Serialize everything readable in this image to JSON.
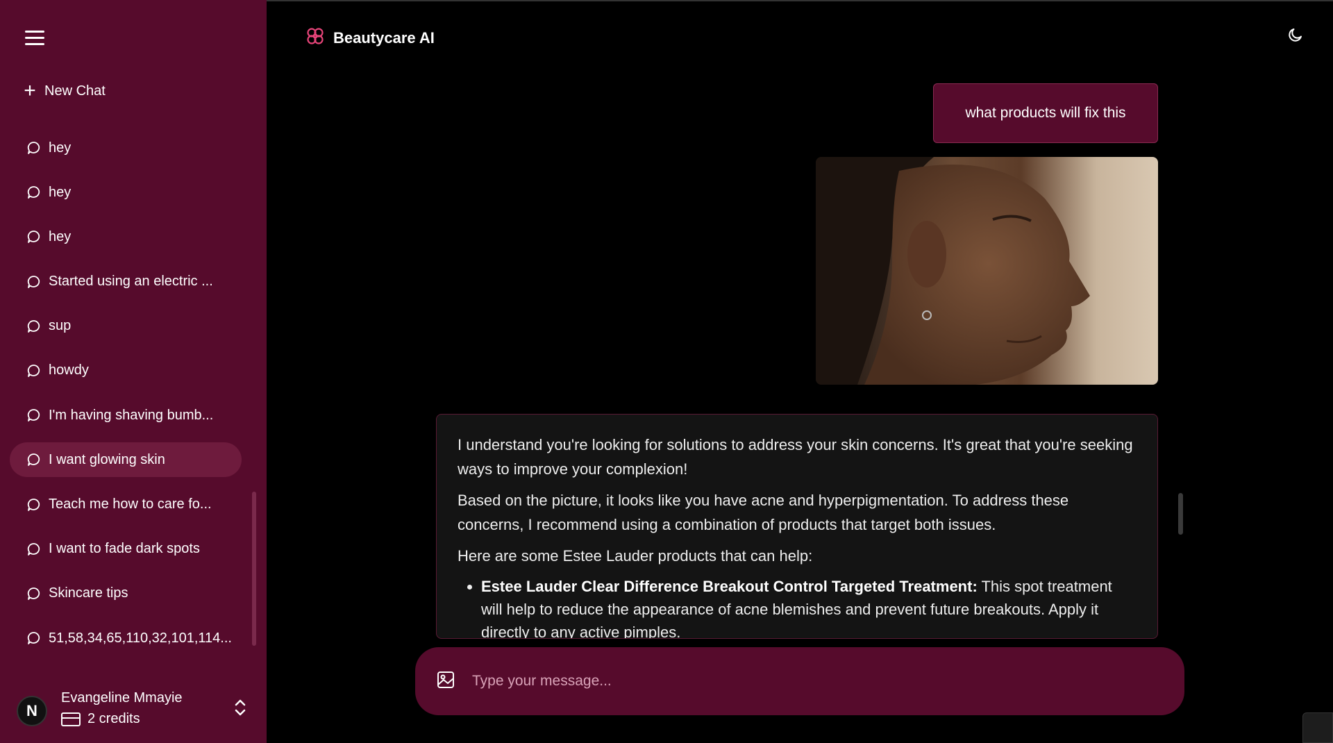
{
  "app": {
    "title": "Beautycare AI"
  },
  "sidebar": {
    "new_chat_label": "New Chat",
    "history": [
      {
        "label": "hey",
        "active": false
      },
      {
        "label": "hey",
        "active": false
      },
      {
        "label": "hey",
        "active": false
      },
      {
        "label": "Started using an electric ...",
        "active": false
      },
      {
        "label": "sup",
        "active": false
      },
      {
        "label": "howdy",
        "active": false
      },
      {
        "label": "I'm having shaving bumb...",
        "active": false
      },
      {
        "label": "I want glowing skin",
        "active": true
      },
      {
        "label": "Teach me how to care fo...",
        "active": false
      },
      {
        "label": "I want to fade dark spots",
        "active": false
      },
      {
        "label": "Skincare tips",
        "active": false
      },
      {
        "label": "51,58,34,65,110,32,101,114...",
        "active": false
      }
    ],
    "user": {
      "initial": "N",
      "name": "Evangeline Mmayie",
      "credits": "2 credits"
    }
  },
  "chat": {
    "user_message": "what products will fix this",
    "assistant": {
      "p1": "I understand you're looking for solutions to address your skin concerns. It's great that you're seeking ways to improve your complexion!",
      "p2": "Based on the picture, it looks like you have acne and hyperpigmentation. To address these concerns, I recommend using a combination of products that target both issues.",
      "p3": "Here are some Estee Lauder products that can help:",
      "bullet1_title": "Estee Lauder Clear Difference Breakout Control Targeted Treatment:",
      "bullet1_text": " This spot treatment will help to reduce the appearance of acne blemishes and prevent future breakouts. Apply it directly to any active pimples."
    }
  },
  "composer": {
    "placeholder": "Type your message..."
  },
  "colors": {
    "sidebar": "#560b2c",
    "accent": "#e8457a",
    "background": "#000000"
  }
}
